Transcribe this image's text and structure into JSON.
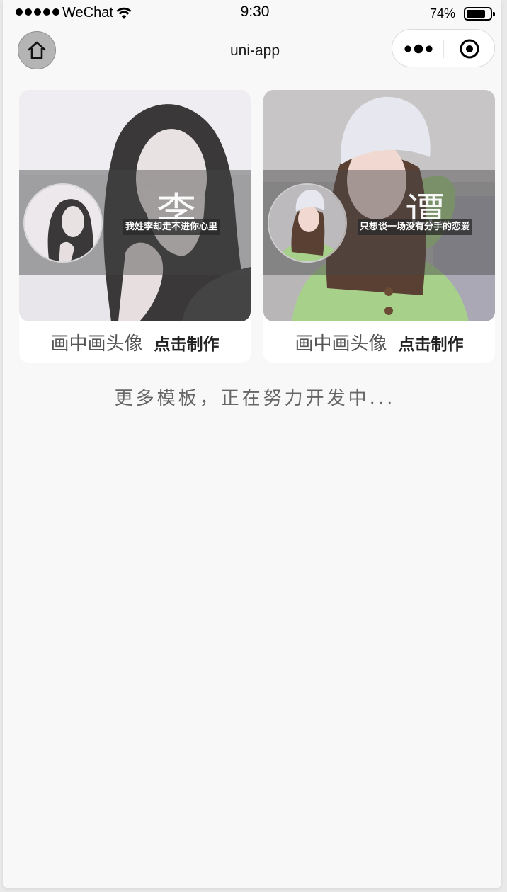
{
  "status_bar": {
    "carrier": "WeChat",
    "time": "9:30",
    "battery_percent": "74%",
    "battery_level": 0.74
  },
  "nav": {
    "title": "uni-app",
    "home_icon": "home-icon",
    "more_icon": "more-dots-icon",
    "close_icon": "target-icon"
  },
  "templates": [
    {
      "big_char": "李",
      "tagline": "我姓李却走不进你心里",
      "name": "画中画头像",
      "action": "点击制作"
    },
    {
      "big_char": "谭",
      "tagline": "只想谈一场没有分手的恋爱",
      "name": "画中画头像",
      "action": "点击制作"
    }
  ],
  "more_note": "更多模板，正在努力开发中..."
}
